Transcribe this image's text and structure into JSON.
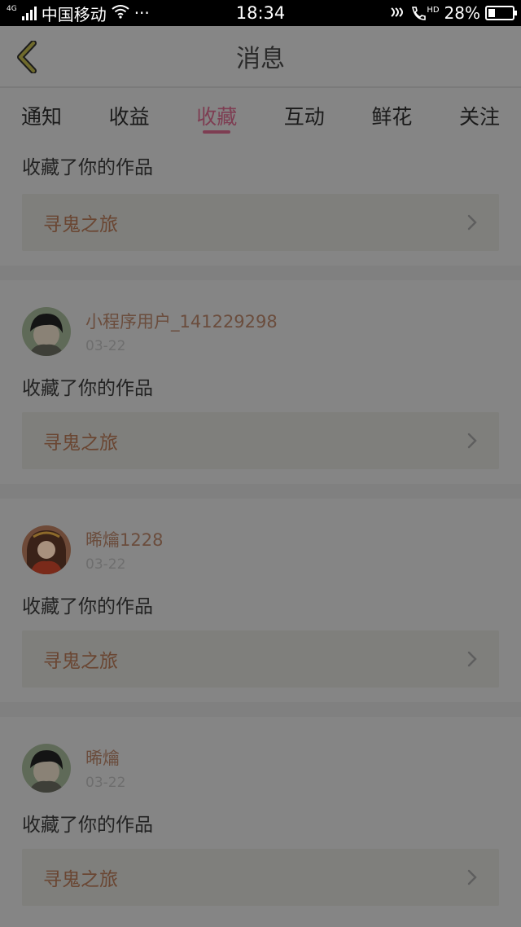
{
  "statusbar": {
    "network_badge": "4G",
    "carrier": "中国移动",
    "more": "···",
    "time": "18:34",
    "battery_text": "28%",
    "battery_level": 0.28,
    "hd_badge": "HD"
  },
  "header": {
    "title": "消息",
    "back_icon": "chevron-left-icon"
  },
  "tabs": [
    {
      "label": "通知"
    },
    {
      "label": "收益"
    },
    {
      "label": "收藏",
      "active": true
    },
    {
      "label": "互动"
    },
    {
      "label": "鲜花"
    },
    {
      "label": "关注"
    }
  ],
  "feed": [
    {
      "username": "",
      "date": "",
      "action": "收藏了你的作品",
      "work": "寻鬼之旅"
    },
    {
      "username": "小程序用户_141229298",
      "date": "03-22",
      "action": "收藏了你的作品",
      "work": "寻鬼之旅",
      "avatar": "dark-hair-avatar"
    },
    {
      "username": "晞爚1228",
      "date": "03-22",
      "action": "收藏了你的作品",
      "work": "寻鬼之旅",
      "avatar": "red-costume-avatar"
    },
    {
      "username": "晞爚",
      "date": "03-22",
      "action": "收藏了你的作品",
      "work": "寻鬼之旅",
      "avatar": "dark-hair-avatar"
    }
  ],
  "colors": {
    "accent": "#7e3d52",
    "username": "#6b4d3d",
    "work_title": "#6a4632"
  }
}
